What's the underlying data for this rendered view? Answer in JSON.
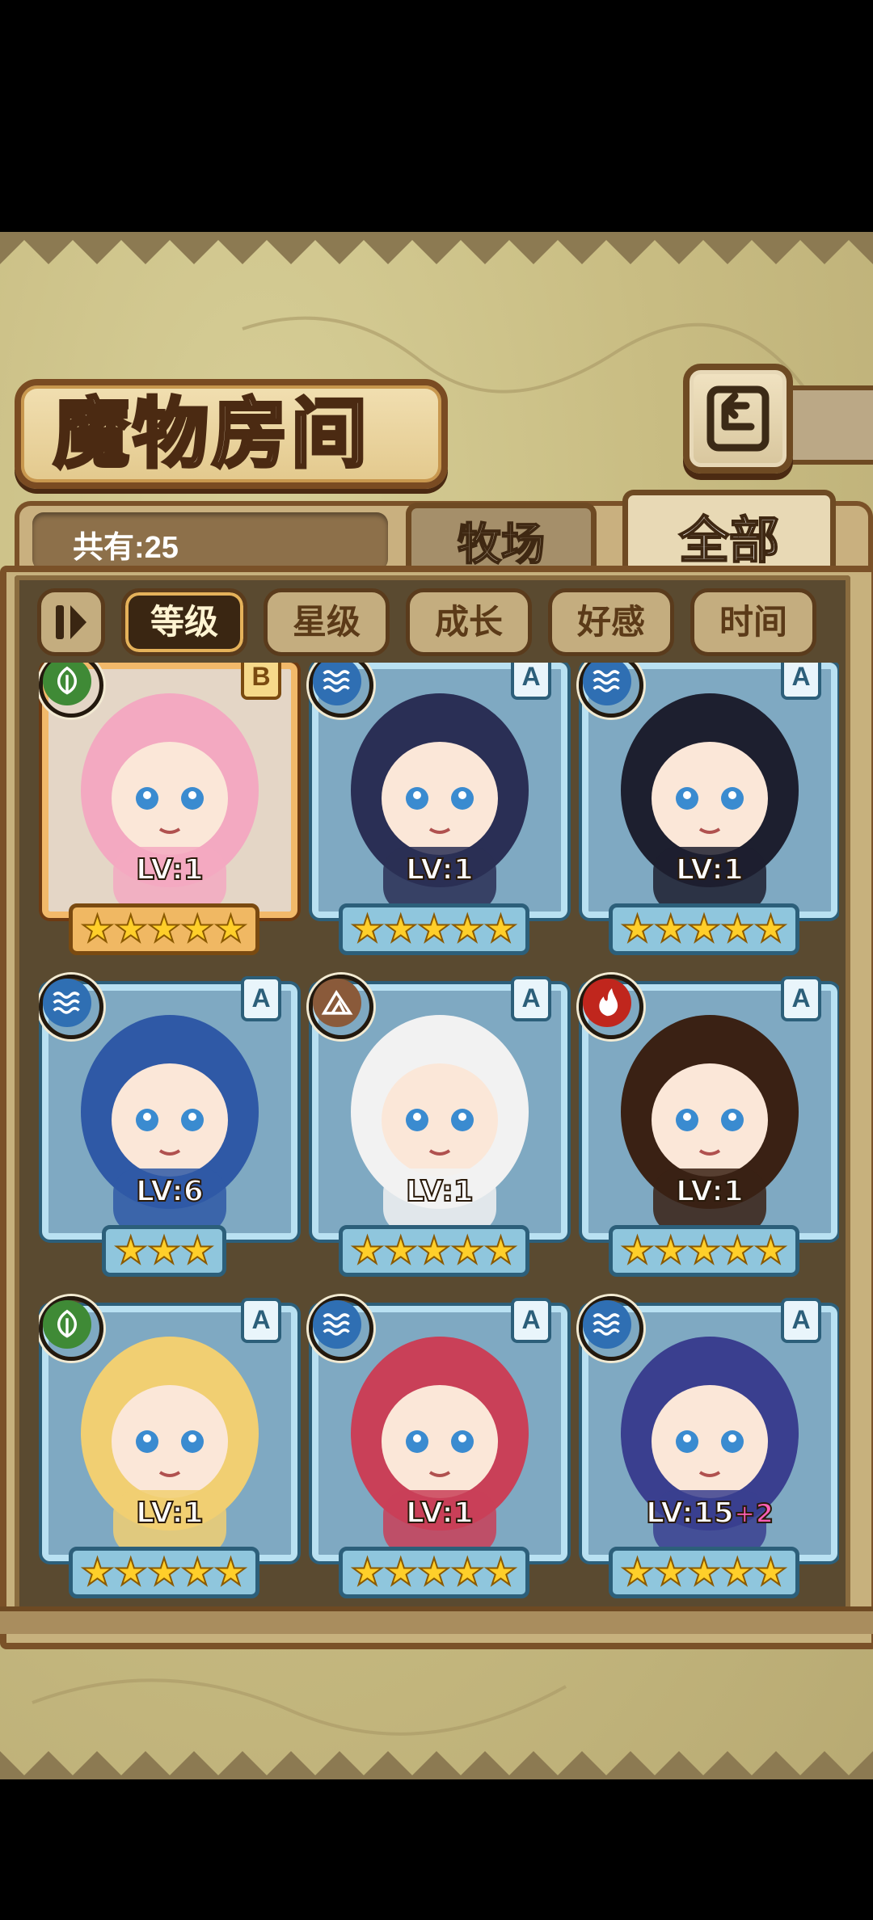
{
  "screen": {
    "title": "魔物房间",
    "count_label": "共有:25",
    "tabs": [
      {
        "label": "牧场",
        "active": false
      },
      {
        "label": "全部",
        "active": true
      }
    ],
    "filters": [
      {
        "label": "等级",
        "active": true
      },
      {
        "label": "星级",
        "active": false
      },
      {
        "label": "成长",
        "active": false
      },
      {
        "label": "好感",
        "active": false
      },
      {
        "label": "时间",
        "active": false
      }
    ],
    "icons": {
      "back": "back-arrow-icon",
      "pause": "pause-icon"
    }
  },
  "monsters": [
    {
      "element": "nature",
      "grade": "B",
      "level": "LV:1",
      "stars": 5,
      "frame": "gold",
      "hair": "#f3a9c1"
    },
    {
      "element": "water",
      "grade": "A",
      "level": "LV:1",
      "stars": 5,
      "frame": "blue",
      "hair": "#2a2f55"
    },
    {
      "element": "water",
      "grade": "A",
      "level": "LV:1",
      "stars": 5,
      "frame": "blue",
      "hair": "#1d1f2f"
    },
    {
      "element": "water",
      "grade": "A",
      "level": "LV:6",
      "stars": 3,
      "frame": "blue",
      "hair": "#2f59a6"
    },
    {
      "element": "earth",
      "grade": "A",
      "level": "LV:1",
      "stars": 5,
      "frame": "blue",
      "hair": "#f2f2f2"
    },
    {
      "element": "fire",
      "grade": "A",
      "level": "LV:1",
      "stars": 5,
      "frame": "blue",
      "hair": "#3a2114"
    },
    {
      "element": "nature",
      "grade": "A",
      "level": "LV:1",
      "stars": 5,
      "frame": "blue",
      "hair": "#f1cf72"
    },
    {
      "element": "water",
      "grade": "A",
      "level": "LV:1",
      "stars": 5,
      "frame": "blue",
      "hair": "#c94058"
    },
    {
      "element": "water",
      "grade": "A",
      "level": "LV:15",
      "bonus": "+2",
      "stars": 5,
      "frame": "blue",
      "hair": "#3a3f8f"
    }
  ],
  "colors": {
    "nature": "#3f8a36",
    "water": "#2f6fb3",
    "earth": "#8a5a3a",
    "fire": "#c0261d"
  }
}
